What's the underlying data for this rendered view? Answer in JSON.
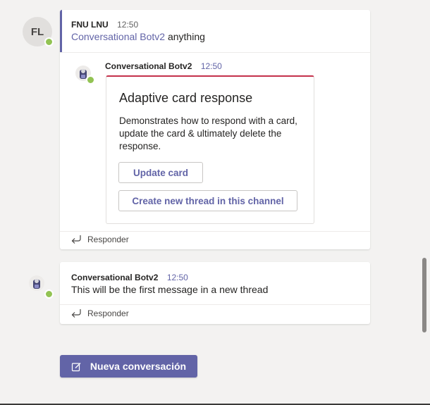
{
  "thread1": {
    "avatar_initials": "FL",
    "author": "FNU LNU",
    "time": "12:50",
    "mention": "Conversational Botv2",
    "message": " anything",
    "reply": {
      "author": "Conversational Botv2",
      "time": "12:50",
      "card": {
        "title": "Adaptive card response",
        "text": "Demonstrates how to respond with a card, update the card & ultimately delete the response.",
        "buttons": [
          "Update card",
          "Create new thread in this channel"
        ]
      }
    },
    "reply_label": "Responder"
  },
  "thread2": {
    "author": "Conversational Botv2",
    "time": "12:50",
    "message": "This will be the first message in a new thread",
    "reply_label": "Responder"
  },
  "new_conversation_label": "Nueva conversación",
  "colors": {
    "accent": "#6264a7",
    "card_top_border": "#c4314b",
    "presence": "#92c353",
    "background": "#f3f2f1"
  },
  "icons": [
    "presence-available-icon",
    "bot-avatar-icon",
    "reply-arrow-icon",
    "compose-icon"
  ]
}
